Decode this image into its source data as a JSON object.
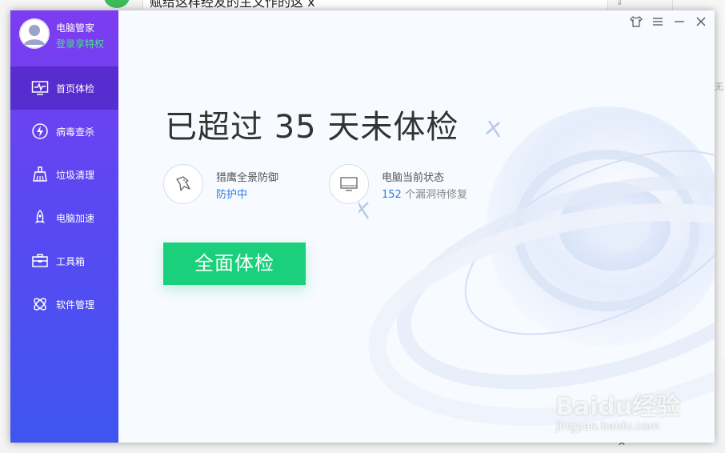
{
  "background_window": {
    "title_fragment": "赋给这样经友的主文作的这 x",
    "right_text": "无"
  },
  "user": {
    "name": "电脑管家",
    "login_link": "登录享特权"
  },
  "nav": {
    "items": [
      {
        "label": "首页体检",
        "icon": "monitor-pulse-icon",
        "active": true
      },
      {
        "label": "病毒查杀",
        "icon": "lightning-shield-icon",
        "active": false
      },
      {
        "label": "垃圾清理",
        "icon": "broom-icon",
        "active": false
      },
      {
        "label": "电脑加速",
        "icon": "rocket-icon",
        "active": false
      },
      {
        "label": "工具箱",
        "icon": "toolbox-icon",
        "active": false
      },
      {
        "label": "软件管理",
        "icon": "apps-icon",
        "active": false
      }
    ]
  },
  "titlebar": {
    "buttons": [
      "skin-icon",
      "menu-icon",
      "minimize-icon",
      "close-icon"
    ]
  },
  "main": {
    "headline": "已超过 35 天未体检",
    "status": [
      {
        "title": "猎鹰全景防御",
        "value": "防护中",
        "icon": "eagle-icon"
      },
      {
        "title": "电脑当前状态",
        "value_number": "152",
        "value_text": " 个漏洞待修复",
        "icon": "monitor-icon"
      }
    ],
    "scan_button": "全面体检"
  },
  "watermark": {
    "brand": "Baidu经验",
    "url": "jingyan.baidu.com"
  },
  "colors": {
    "sidebar_top": "#7d3cf0",
    "sidebar_bottom": "#3f55f0",
    "accent_green": "#1bd07a",
    "link_blue": "#2d7be5",
    "login_green": "#49e08a"
  }
}
